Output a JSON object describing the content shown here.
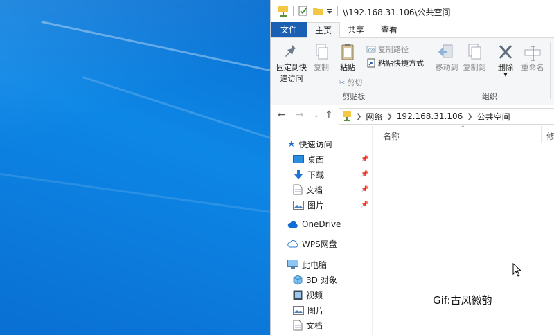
{
  "window": {
    "title": "\\\\192.168.31.106\\公共空间"
  },
  "tabs": [
    {
      "label": "文件"
    },
    {
      "label": "主页"
    },
    {
      "label": "共享"
    },
    {
      "label": "查看"
    }
  ],
  "ribbon": {
    "pin_quick_access_line1": "固定到快",
    "pin_quick_access_line2": "速访问",
    "copy": "复制",
    "paste": "粘贴",
    "copy_path": "复制路径",
    "paste_shortcut": "粘贴快捷方式",
    "cut": "剪切",
    "clipboard_group": "剪贴板",
    "move_to": "移动到",
    "copy_to": "复制到",
    "delete": "删除",
    "rename": "重命名",
    "organize_group": "组织"
  },
  "address": {
    "crumbs": [
      "网络",
      "192.168.31.106",
      "公共空间"
    ]
  },
  "nav_pane": {
    "quick_access": "快速访问",
    "desktop": "桌面",
    "downloads": "下载",
    "documents": "文档",
    "pictures": "图片",
    "onedrive": "OneDrive",
    "wps": "WPS网盘",
    "this_pc": "此电脑",
    "objects3d": "3D 对象",
    "videos": "视频",
    "pc_pictures": "图片",
    "pc_documents": "文档"
  },
  "file_pane": {
    "col_name": "名称",
    "col_modified": "修"
  },
  "watermark": "Gif:古风徽韵",
  "colors": {
    "desktop_blue": "#0a78d7",
    "file_tab_blue": "#1a5fb4",
    "folder_yellow": "#f3c644"
  }
}
